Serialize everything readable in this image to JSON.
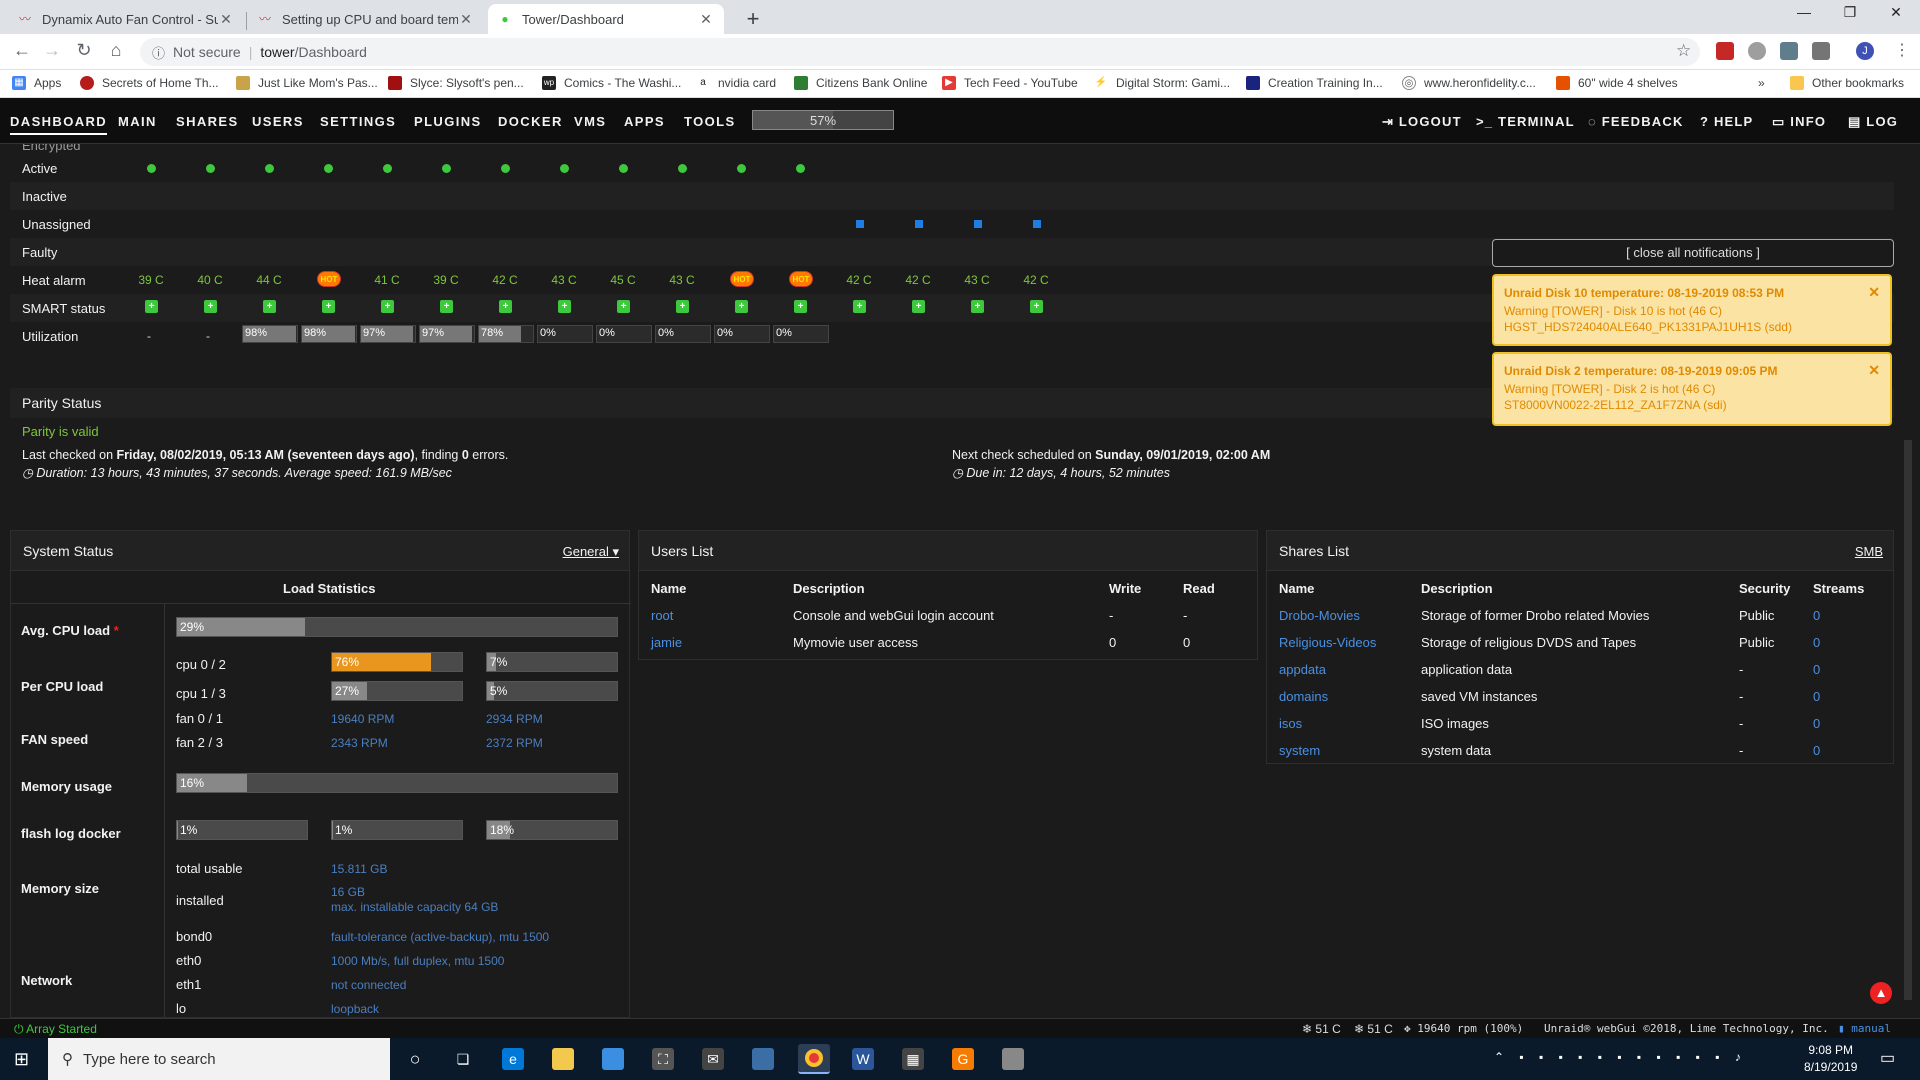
{
  "browser": {
    "tabs": [
      {
        "title": "Dynamix Auto Fan Control - Sudo",
        "active": false
      },
      {
        "title": "Setting up CPU and board temp",
        "active": false
      },
      {
        "title": "Tower/Dashboard",
        "active": true
      }
    ],
    "security": "Not secure",
    "url_host": "tower",
    "url_path": "/Dashboard",
    "bookmarks": [
      "Apps",
      "Secrets of Home Th...",
      "Just Like Mom's Pas...",
      "Slyce: Slysoft's pen...",
      "Comics - The Washi...",
      "nvidia card",
      "Citizens Bank Online",
      "Tech Feed - YouTube",
      "Digital Storm: Gami...",
      "Creation Training In...",
      "www.heronfidelity.c...",
      "60\" wide 4 shelves",
      "»",
      "Other bookmarks"
    ]
  },
  "nav": {
    "items": [
      "DASHBOARD",
      "MAIN",
      "SHARES",
      "USERS",
      "SETTINGS",
      "PLUGINS",
      "DOCKER",
      "VMS",
      "APPS",
      "TOOLS"
    ],
    "usage": "57%",
    "usage_fraction": 0.57,
    "right": [
      "LOGOUT",
      "TERMINAL",
      "FEEDBACK",
      "HELP",
      "INFO",
      "LOG"
    ]
  },
  "array": {
    "top_partial": "Encrypted",
    "rows": [
      "Active",
      "Inactive",
      "Unassigned",
      "Faulty",
      "Heat alarm",
      "SMART status",
      "Utilization"
    ],
    "heat": [
      "39 C",
      "40 C",
      "44 C",
      "HOT",
      "41 C",
      "39 C",
      "42 C",
      "43 C",
      "45 C",
      "43 C",
      "HOT",
      "HOT",
      "42 C",
      "42 C",
      "43 C",
      "42 C"
    ],
    "util_plain": [
      "-",
      "-"
    ],
    "util_bars": [
      {
        "label": "98%",
        "v": 0.98
      },
      {
        "label": "98%",
        "v": 0.98
      },
      {
        "label": "97%",
        "v": 0.97
      },
      {
        "label": "97%",
        "v": 0.97
      },
      {
        "label": "78%",
        "v": 0.78
      },
      {
        "label": "0%",
        "v": 0
      },
      {
        "label": "0%",
        "v": 0
      },
      {
        "label": "0%",
        "v": 0
      },
      {
        "label": "0%",
        "v": 0
      },
      {
        "label": "0%",
        "v": 0
      }
    ]
  },
  "parity": {
    "title": "Parity Status",
    "status": "Parity is valid",
    "last_pre": "Last checked on ",
    "last_date": "Friday, 08/02/2019, 05:13 AM (seventeen days ago)",
    "last_mid": ", finding ",
    "last_err": "0",
    "last_post": " errors.",
    "duration": "Duration: 13 hours, 43 minutes, 37 seconds. Average speed: 161.9 MB/sec",
    "next_pre": "Next check scheduled on ",
    "next_date": "Sunday, 09/01/2019, 02:00 AM",
    "due": "Due in: 12 days, 4 hours, 52 minutes"
  },
  "notifications": {
    "close_all": "[ close all notifications ]",
    "items": [
      {
        "title": "Unraid Disk 10 temperature: 08-19-2019 08:53 PM",
        "line1": "Warning [TOWER] - Disk 10 is hot (46 C)",
        "line2": "HGST_HDS724040ALE640_PK1331PAJ1UH1S (sdd)"
      },
      {
        "title": "Unraid Disk 2 temperature: 08-19-2019 09:05 PM",
        "line1": "Warning [TOWER] - Disk 2 is hot (46 C)",
        "line2": "ST8000VN0022-2EL112_ZA1F7ZNA (sdi)"
      }
    ]
  },
  "system": {
    "title": "System Status",
    "mode": "General ▾",
    "load_header": "Load Statistics",
    "avg_label": "Avg. CPU load",
    "avg": {
      "label": "29%",
      "v": 0.29
    },
    "per_label": "Per CPU load",
    "cpu_rows": [
      {
        "name": "cpu 0 / 2",
        "a": {
          "label": "76%",
          "v": 0.76
        },
        "b": {
          "label": "7%",
          "v": 0.07
        }
      },
      {
        "name": "cpu 1 / 3",
        "a": {
          "label": "27%",
          "v": 0.27
        },
        "b": {
          "label": "5%",
          "v": 0.05
        }
      }
    ],
    "fan_label": "FAN speed",
    "fans": [
      {
        "name": "fan 0 / 1",
        "a": "19640 RPM",
        "b": "2934 RPM"
      },
      {
        "name": "fan 2 / 3",
        "a": "2343 RPM",
        "b": "2372 RPM"
      }
    ],
    "mem_label": "Memory usage",
    "mem": {
      "label": "16%",
      "v": 0.16
    },
    "flash_label": "flash log docker",
    "flash": [
      {
        "label": "1%",
        "v": 0.01
      },
      {
        "label": "1%",
        "v": 0.01
      },
      {
        "label": "18%",
        "v": 0.18
      }
    ],
    "size_label": "Memory size",
    "total_usable_l": "total usable",
    "total_usable": "15.811 GB",
    "installed_l": "installed",
    "installed": "16 GB",
    "max_cap": "max. installable capacity 64 GB",
    "net_label": "Network",
    "net": [
      {
        "k": "bond0",
        "v": "fault-tolerance (active-backup), mtu 1500"
      },
      {
        "k": "eth0",
        "v": "1000 Mb/s, full duplex, mtu 1500"
      },
      {
        "k": "eth1",
        "v": "not connected"
      },
      {
        "k": "lo",
        "v": "loopback"
      }
    ]
  },
  "users": {
    "title": "Users List",
    "headers": [
      "Name",
      "Description",
      "Write",
      "Read"
    ],
    "rows": [
      {
        "name": "root",
        "desc": "Console and webGui login account",
        "write": "-",
        "read": "-"
      },
      {
        "name": "jamie",
        "desc": "Mymovie user access",
        "write": "0",
        "read": "0"
      }
    ]
  },
  "shares": {
    "title": "Shares List",
    "mode": "SMB",
    "headers": [
      "Name",
      "Description",
      "Security",
      "Streams"
    ],
    "rows": [
      {
        "name": "Drobo-Movies",
        "desc": "Storage of former Drobo related Movies",
        "sec": "Public",
        "streams": "0"
      },
      {
        "name": "Religious-Videos",
        "desc": "Storage of religious DVDS and Tapes",
        "sec": "Public",
        "streams": "0"
      },
      {
        "name": "appdata",
        "desc": "application data",
        "sec": "-",
        "streams": "0"
      },
      {
        "name": "domains",
        "desc": "saved VM instances",
        "sec": "-",
        "streams": "0"
      },
      {
        "name": "isos",
        "desc": "ISO images",
        "sec": "-",
        "streams": "0"
      },
      {
        "name": "system",
        "desc": "system data",
        "sec": "-",
        "streams": "0"
      }
    ]
  },
  "footer": {
    "status": "Array Started",
    "temp1": "51 C",
    "temp2": "51 C",
    "fan": "19640 rpm (100%)",
    "copyright": "Unraid® webGui ©2018, Lime Technology, Inc.",
    "manual": "manual"
  },
  "taskbar": {
    "search": "Type here to search",
    "time": "9:08 PM",
    "date": "8/19/2019"
  },
  "colors": {
    "accent_orange": "#ff8c00",
    "ok_green": "#3ec83e",
    "link_blue": "#4a90e2",
    "warn_text": "#e08a00"
  }
}
